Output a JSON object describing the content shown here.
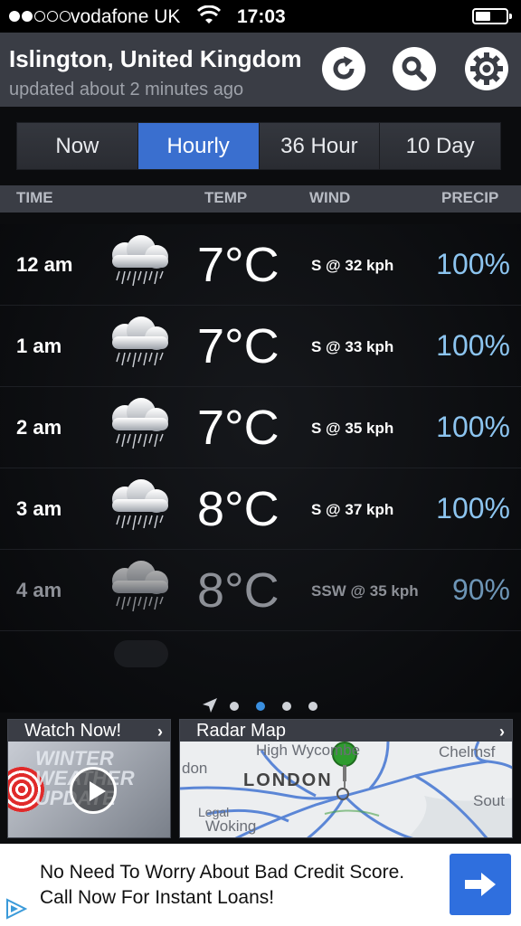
{
  "status_bar": {
    "carrier": "vodafone UK",
    "time": "17:03",
    "battery_level": 0.5
  },
  "header": {
    "location": "Islington, United Kingdom",
    "updated": "updated about 2 minutes ago",
    "icons": [
      "refresh-icon",
      "search-icon",
      "settings-icon"
    ]
  },
  "tabs": [
    {
      "label": "Now",
      "active": false
    },
    {
      "label": "Hourly",
      "active": true
    },
    {
      "label": "36 Hour",
      "active": false
    },
    {
      "label": "10 Day",
      "active": false
    }
  ],
  "table": {
    "headers": {
      "time": "TIME",
      "temp": "TEMP",
      "wind": "WIND",
      "precip": "PRECIP"
    },
    "rows": [
      {
        "time": "12 am",
        "icon": "rain-cloud-icon",
        "temp": "7°C",
        "wind": "S @ 32 kph",
        "precip": "100%"
      },
      {
        "time": "1 am",
        "icon": "rain-cloud-icon",
        "temp": "7°C",
        "wind": "S @ 33 kph",
        "precip": "100%"
      },
      {
        "time": "2 am",
        "icon": "rain-cloud-icon",
        "temp": "7°C",
        "wind": "S @ 35 kph",
        "precip": "100%"
      },
      {
        "time": "3 am",
        "icon": "rain-cloud-icon",
        "temp": "8°C",
        "wind": "S @ 37 kph",
        "precip": "100%"
      },
      {
        "time": "4 am",
        "icon": "rain-cloud-icon",
        "temp": "8°C",
        "wind": "SSW @ 35 kph",
        "precip": "90%"
      }
    ]
  },
  "pager": {
    "pages": 4,
    "active_index": 1,
    "has_location_arrow": true
  },
  "cards": {
    "video": {
      "title": "Watch Now!",
      "thumbnail_text": "WINTER WEATHER UPDATE"
    },
    "radar": {
      "title": "Radar Map",
      "map_labels": [
        "High Wycombe",
        "Chelmsf",
        "don",
        "LONDON",
        "Sout",
        "Legal",
        "Woking"
      ]
    }
  },
  "ad": {
    "text": "No Need To Worry About Bad Credit Score. Call Now For Instant Loans!",
    "button_icon": "arrow-right-icon"
  },
  "colors": {
    "accent": "#3a6fcf",
    "header_bg": "#3a3d45",
    "precip": "#8cc4ef",
    "pager_active": "#3a8fe0"
  }
}
